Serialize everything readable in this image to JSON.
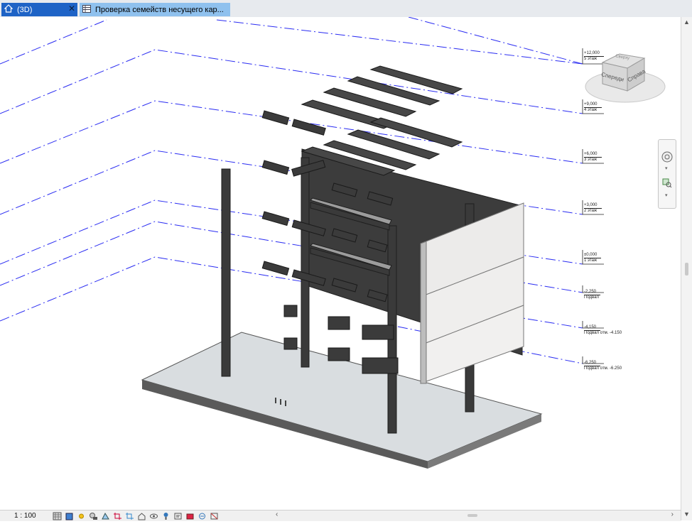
{
  "tabs": [
    {
      "label": "(3D)",
      "active": true
    },
    {
      "label": "Проверка семейств несущего кар...",
      "active": false
    }
  ],
  "status": {
    "scale": "1 : 100"
  },
  "viewcube": {
    "top_label": "Сверху",
    "front_label": "Спереди",
    "right_label": "Справа"
  },
  "levels": [
    {
      "elev": "+12,000",
      "name": "5 этаж"
    },
    {
      "elev": "+9,000",
      "name": "4 этаж"
    },
    {
      "elev": "+6,000",
      "name": "3 этаж"
    },
    {
      "elev": "+3,000",
      "name": "2 этаж"
    },
    {
      "elev": "±0,000",
      "name": "1 этаж"
    },
    {
      "elev": "-2,250",
      "name": "Подвал"
    },
    {
      "elev": "-4,150",
      "name": "Подвал отм. -4.150"
    },
    {
      "elev": "-6,250",
      "name": "Подвал отм. -6.250"
    }
  ],
  "colors": {
    "level_line": "#2a2cf2",
    "tab_active": "#1e63c6",
    "tab_inactive": "#8fc1ee",
    "dark_element": "#3a3a3a",
    "slab": "#d9dde0"
  }
}
